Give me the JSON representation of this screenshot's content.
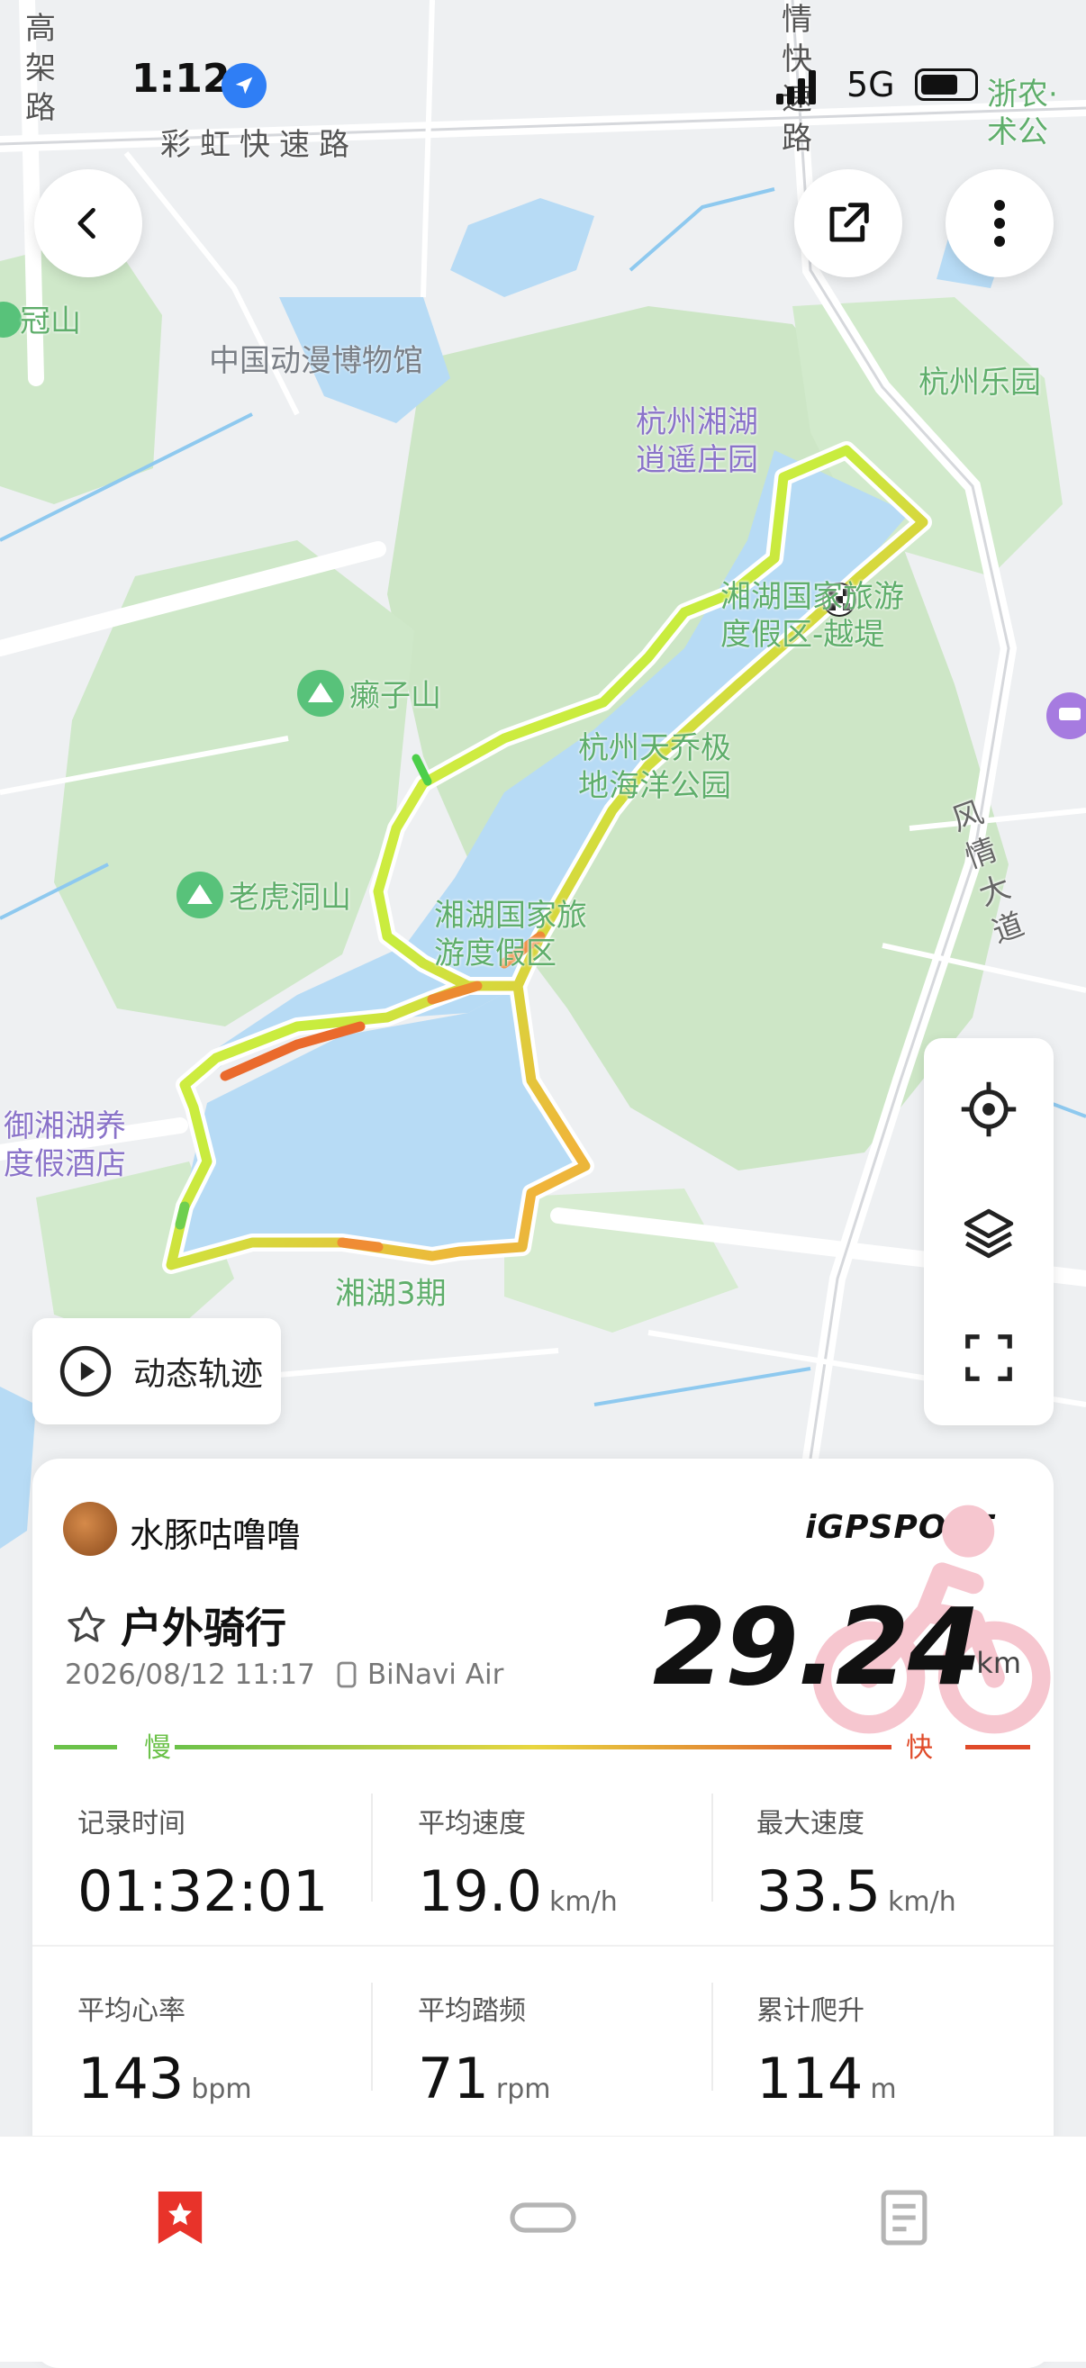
{
  "status_bar": {
    "time": "1:12",
    "network": "5G"
  },
  "map": {
    "labels": {
      "gaojia_road": "高架路",
      "rainbow_expressway": "彩虹快速路",
      "qingkuai_road": "情快速路",
      "guanshan": "冠山",
      "animation_museum": "中国动漫博物馆",
      "xianghu_resort_park": "杭州湘湖\n逍遥庄园",
      "hangzhou_paradise": "杭州乐园",
      "zhejiang_agri": "浙农·\n术公",
      "lizishan": "癞子山",
      "xianghu_tourism_yue": "湘湖国家旅游\n度假区-越堤",
      "tianqiaoji_park": "杭州天乔极\n地海洋公园",
      "laohudongshan": "老虎洞山",
      "xianghu_tourism": "湘湖国家旅\n游度假区",
      "fengqing_avenue": "风情大道",
      "yuxianghu_hotel": "御湘湖养\n度假酒店",
      "xianghu_phase3": "湘湖3期"
    }
  },
  "controls": {
    "back_icon": "chevron-left-icon",
    "share_icon": "share-icon",
    "more_icon": "more-vertical-icon",
    "locate_icon": "crosshair-icon",
    "layers_icon": "layers-icon",
    "fullscreen_icon": "fullscreen-icon",
    "replay_label": "动态轨迹"
  },
  "activity": {
    "user_name": "水豚咕噜噜",
    "brand": "iGPSPORT",
    "type": "户外骑行",
    "datetime": "2026/08/12 11:17",
    "device": "BiNavi Air",
    "distance": "29.24",
    "distance_unit": "km",
    "legend_slow": "慢",
    "legend_fast": "快",
    "stats": [
      {
        "label": "记录时间",
        "value": "01:32:01",
        "unit": ""
      },
      {
        "label": "平均速度",
        "value": "19.0",
        "unit": "km/h"
      },
      {
        "label": "最大速度",
        "value": "33.5",
        "unit": "km/h"
      },
      {
        "label": "平均心率",
        "value": "143",
        "unit": "bpm"
      },
      {
        "label": "平均踏频",
        "value": "71",
        "unit": "rpm"
      },
      {
        "label": "累计爬升",
        "value": "114",
        "unit": "m"
      }
    ]
  },
  "colors": {
    "accent": "#e8332a",
    "speed_slow": "#6cc24a",
    "speed_fast": "#e04b2a"
  },
  "tabbar": {
    "items": [
      "bookmark-icon",
      "link-icon",
      "document-icon"
    ]
  }
}
